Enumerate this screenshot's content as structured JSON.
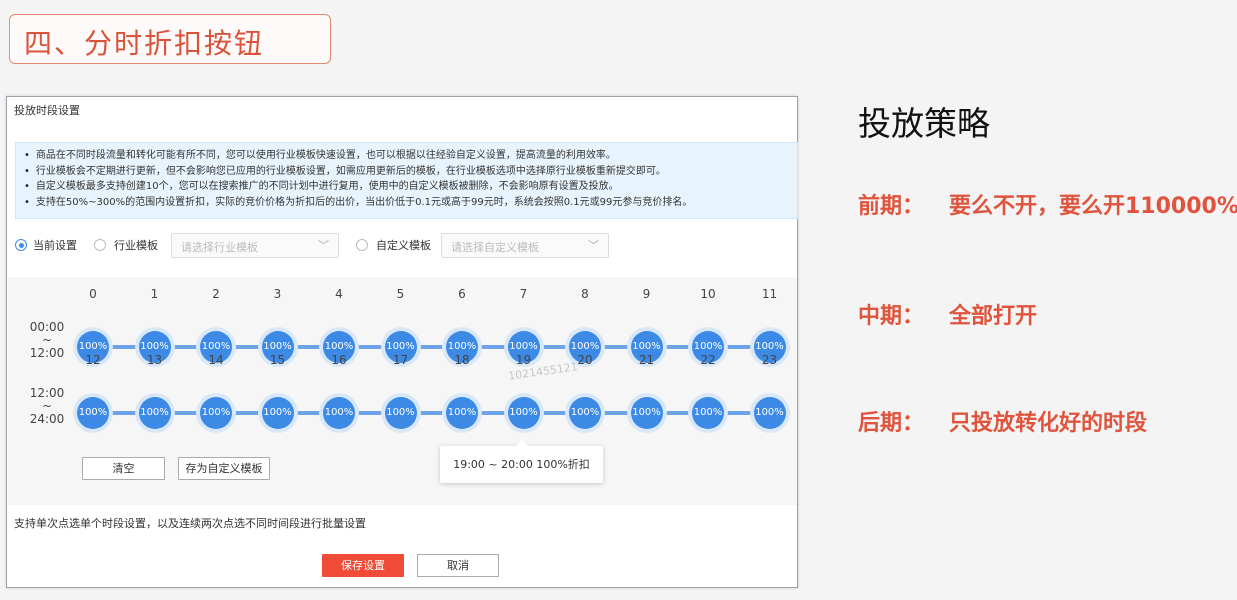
{
  "heading": "四、分时折扣按钮",
  "panel": {
    "title": "投放时段设置",
    "notices": [
      "商品在不同时段流量和转化可能有所不同，您可以使用行业模板快速设置，也可以根据以往经验自定义设置，提高流量的利用效率。",
      "行业模板会不定期进行更新，但不会影响您已应用的行业模板设置，如需应用更新后的模板，在行业模板选项中选择原行业模板重新提交即可。",
      "自定义模板最多支持创建10个，您可以在搜索推广的不同计划中进行复用，使用中的自定义模板被删除，不会影响原有设置及投放。",
      "支持在50%~300%的范围内设置折扣，实际的竞价价格为折扣后的出价，当出价低于0.1元或高于99元时，系统会按照0.1元或99元参与竞价排名。"
    ],
    "options": {
      "current": "当前设置",
      "industry": "行业模板",
      "industry_placeholder": "请选择行业模板",
      "custom": "自定义模板",
      "custom_placeholder": "请选择自定义模板"
    },
    "ranges": {
      "am": {
        "start": "00:00",
        "tilde": "~",
        "end": "12:00"
      },
      "pm": {
        "start": "12:00",
        "tilde": "~",
        "end": "24:00"
      }
    },
    "hours_am": [
      {
        "hour": "0",
        "pct": "100%"
      },
      {
        "hour": "1",
        "pct": "100%"
      },
      {
        "hour": "2",
        "pct": "100%"
      },
      {
        "hour": "3",
        "pct": "100%"
      },
      {
        "hour": "4",
        "pct": "100%"
      },
      {
        "hour": "5",
        "pct": "100%"
      },
      {
        "hour": "6",
        "pct": "100%"
      },
      {
        "hour": "7",
        "pct": "100%"
      },
      {
        "hour": "8",
        "pct": "100%"
      },
      {
        "hour": "9",
        "pct": "100%"
      },
      {
        "hour": "10",
        "pct": "100%"
      },
      {
        "hour": "11",
        "pct": "100%"
      }
    ],
    "hours_pm": [
      {
        "hour": "12",
        "pct": "100%"
      },
      {
        "hour": "13",
        "pct": "100%"
      },
      {
        "hour": "14",
        "pct": "100%"
      },
      {
        "hour": "15",
        "pct": "100%"
      },
      {
        "hour": "16",
        "pct": "100%"
      },
      {
        "hour": "17",
        "pct": "100%"
      },
      {
        "hour": "18",
        "pct": "100%"
      },
      {
        "hour": "19",
        "pct": "100%"
      },
      {
        "hour": "20",
        "pct": "100%"
      },
      {
        "hour": "21",
        "pct": "100%"
      },
      {
        "hour": "22",
        "pct": "100%"
      },
      {
        "hour": "23",
        "pct": "100%"
      }
    ],
    "clear_label": "清空",
    "save_template_label": "存为自定义模板",
    "tooltip": "19:00 ~ 20:00 100%折扣",
    "watermark": "1021455121",
    "hint": "支持单次点选单个时段设置，以及连续两次点选不同时间段进行批量设置",
    "save_label": "保存设置",
    "cancel_label": "取消"
  },
  "strategy": {
    "title": "投放策略",
    "rows": [
      {
        "label": "前期：",
        "value": "要么不开，要么开110000%"
      },
      {
        "label": "中期：",
        "value": "全部打开"
      },
      {
        "label": "后期：",
        "value": "只投放转化好的时段"
      }
    ]
  },
  "colors": {
    "accent": "#3c8ae6",
    "heading": "#d9533b",
    "save": "#f04b36"
  }
}
